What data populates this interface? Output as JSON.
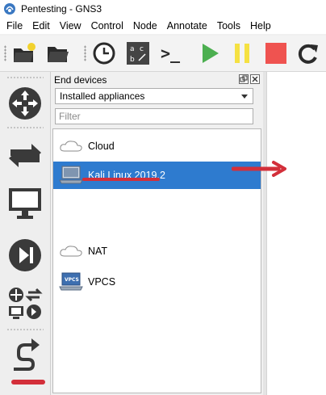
{
  "window": {
    "title": "Pentesting - GNS3",
    "app_icon": "gns3-logo-icon"
  },
  "menu": [
    "File",
    "Edit",
    "View",
    "Control",
    "Node",
    "Annotate",
    "Tools",
    "Help"
  ],
  "toolbar": {
    "icons": [
      "open-folder-new-icon",
      "open-folder-icon",
      "clock-icon",
      "abc-label-icon",
      "console-prompt-icon",
      "start-play-icon",
      "pause-icon",
      "stop-icon",
      "reload-icon"
    ],
    "console_glyph": ">_"
  },
  "left_toolbar": {
    "icons": [
      "routers-icon",
      "switches-icon",
      "end-devices-monitor-icon",
      "security-devices-icon",
      "all-devices-icon",
      "add-link-icon"
    ]
  },
  "panel": {
    "title": "End devices",
    "dropdown_value": "Installed appliances",
    "filter_placeholder": "Filter",
    "filter_value": "",
    "items": [
      {
        "label": "Cloud",
        "icon": "cloud-icon"
      },
      {
        "label": "Kali Linux 2019.2",
        "icon": "laptop-icon",
        "selected": true
      },
      {
        "label": "NAT",
        "icon": "cloud-icon"
      },
      {
        "label": "VPCS",
        "icon": "vpcs-laptop-icon",
        "badge": "VPCS"
      }
    ]
  },
  "colors": {
    "selection": "#2e7bcf",
    "annotation": "#d32f3a",
    "play": "#4caf50",
    "pause": "#f5e142",
    "stop": "#ef5350"
  }
}
